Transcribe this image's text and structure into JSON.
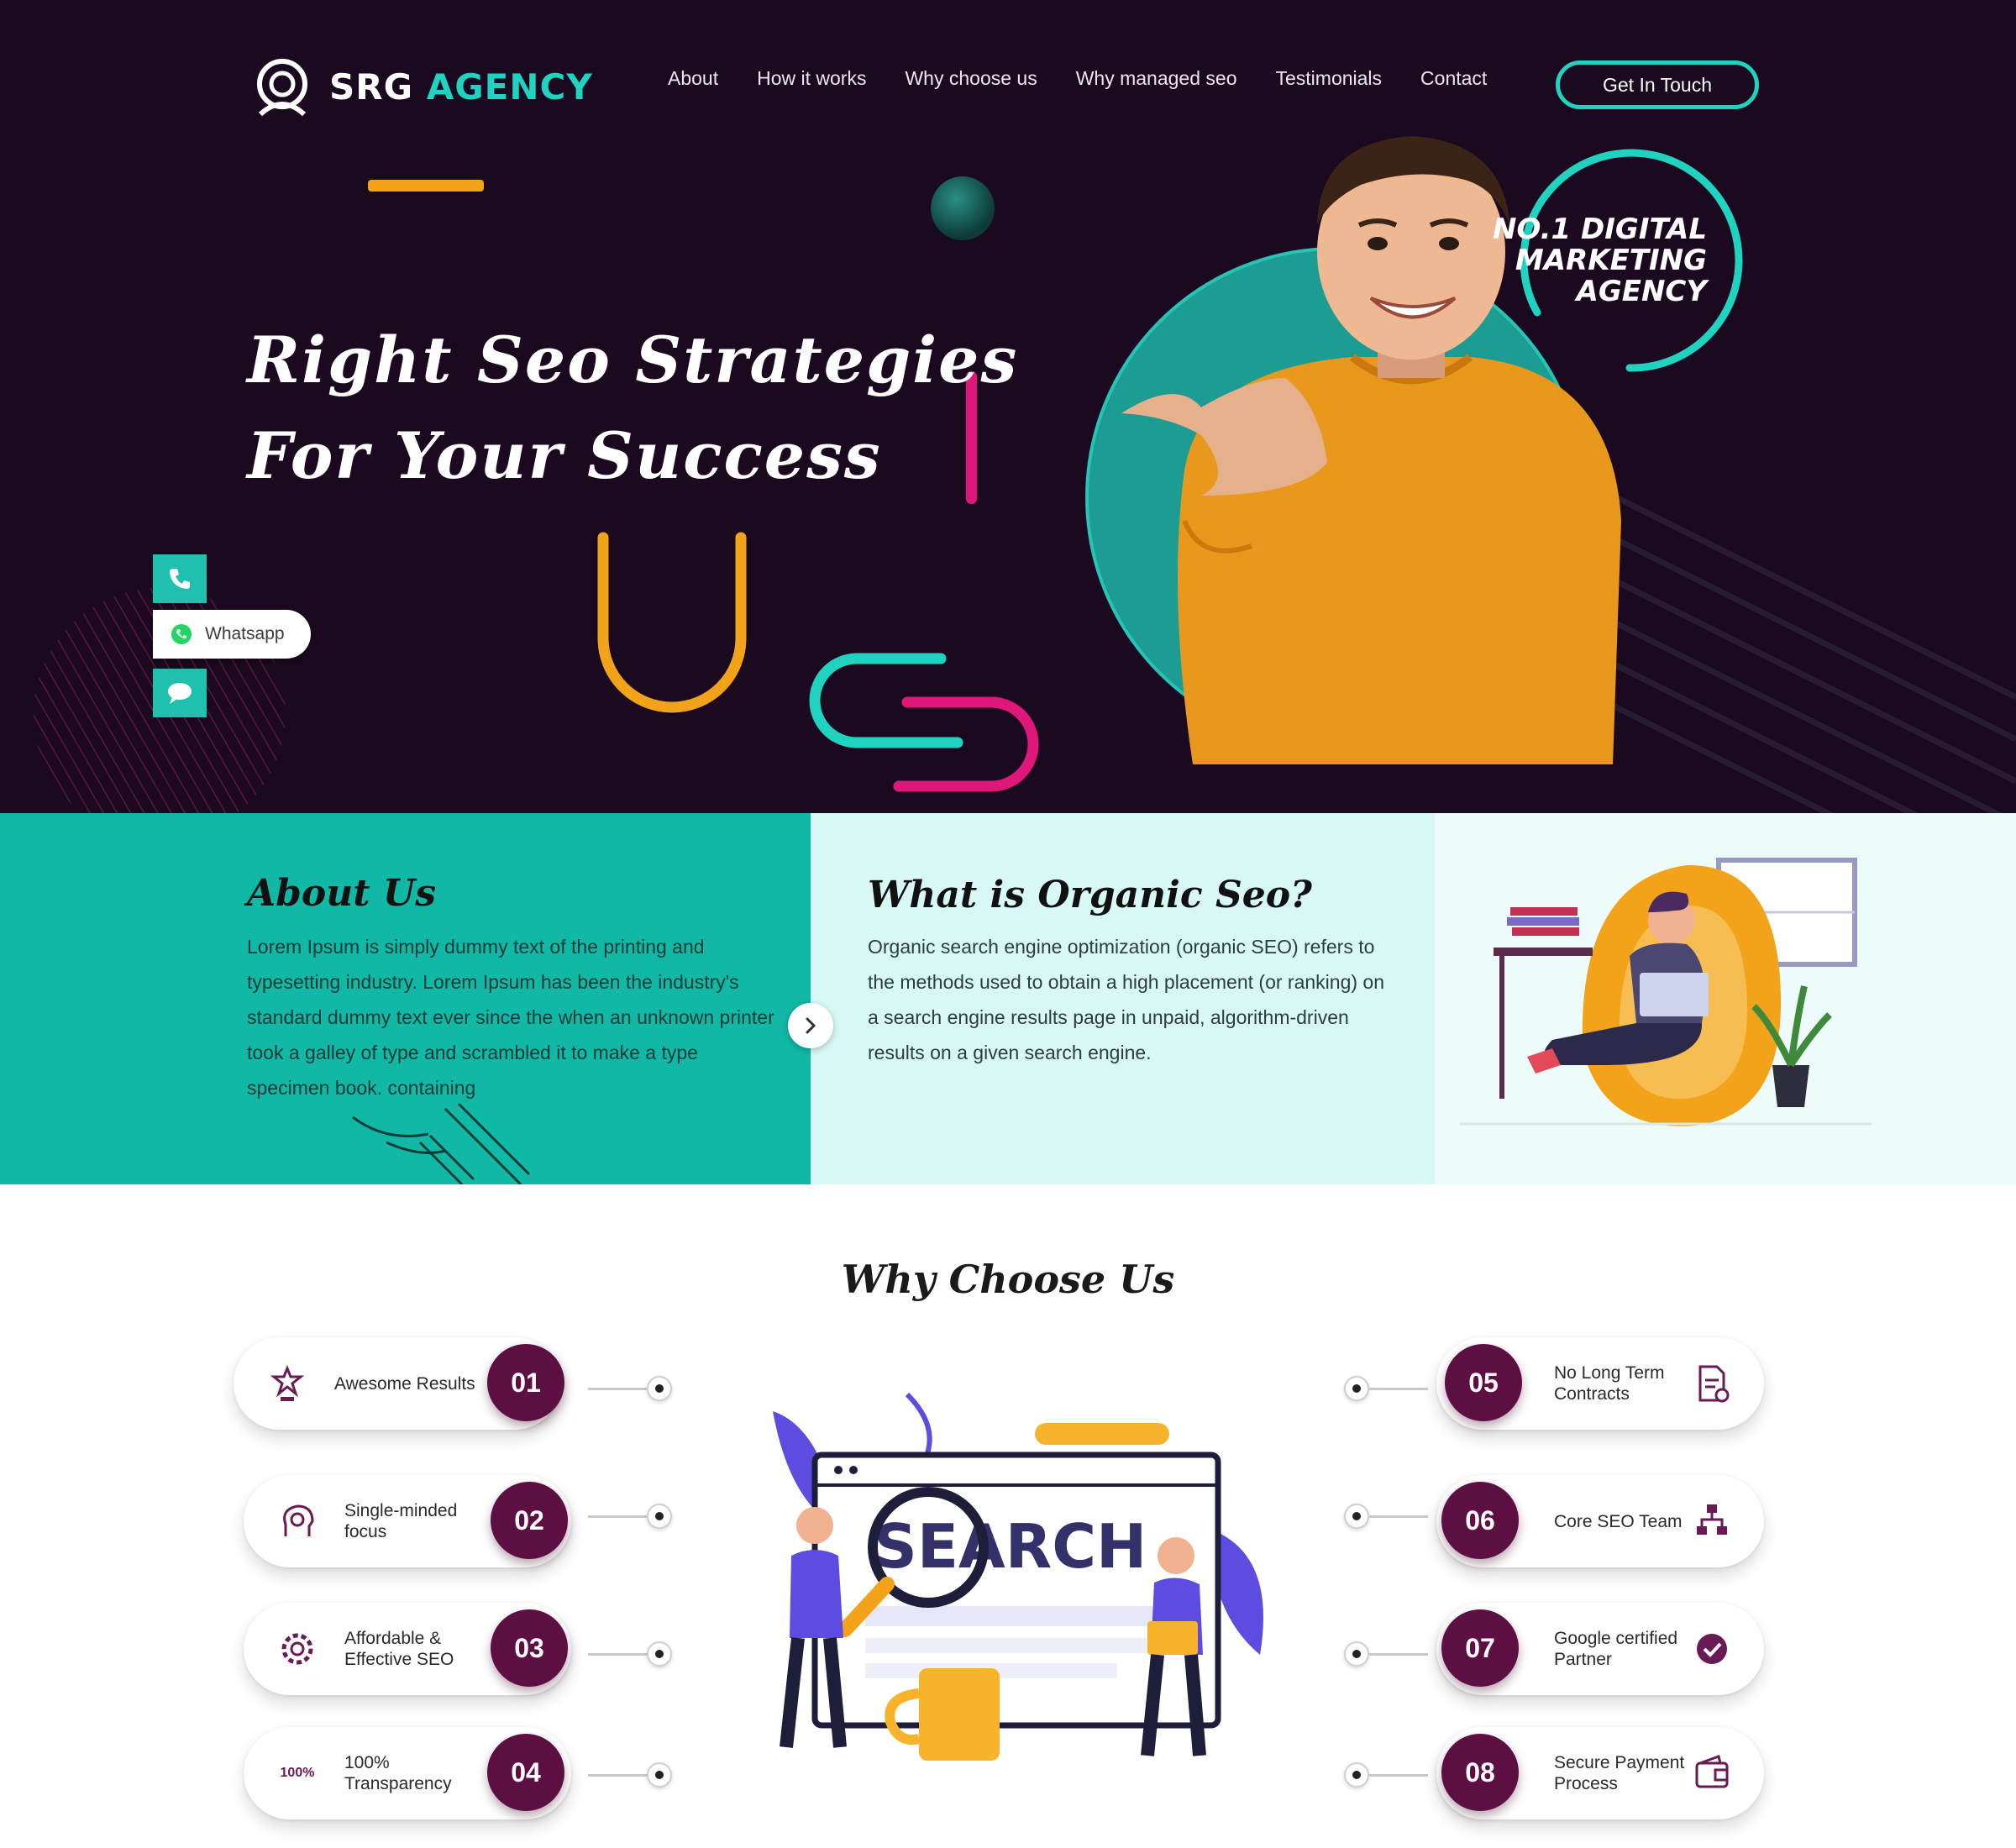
{
  "brand": {
    "name_part1": "SRG",
    "name_part2": "AGENCY"
  },
  "nav": {
    "links": [
      "About",
      "How it works",
      "Why choose us",
      "Why managed seo",
      "Testimonials",
      "Contact"
    ],
    "cta": "Get In Touch"
  },
  "hero": {
    "title_line1": "Right Seo Strategies",
    "title_line2": "For Your Success",
    "badge_line1": "NO.1 DIGITAL",
    "badge_line2": "MARKETING",
    "badge_line3": "AGENCY"
  },
  "side_buttons": {
    "whatsapp_label": "Whatsapp"
  },
  "about": {
    "title": "About Us",
    "body": "Lorem Ipsum is simply dummy text of the printing and typesetting industry. Lorem Ipsum has been the industry's standard dummy text ever since the when an unknown printer took a galley of type and scrambled it to make a type specimen book. containing"
  },
  "organic": {
    "title": "What is Organic Seo?",
    "body": "Organic search engine optimization (organic SEO) refers to the methods used to obtain a high placement (or ranking) on a search engine results page in unpaid, algorithm-driven results on a given search engine."
  },
  "why": {
    "title": "Why Choose Us",
    "search_word": "SEARCH",
    "left": [
      {
        "num": "01",
        "label": "Awesome Results",
        "icon": "trophy-icon"
      },
      {
        "num": "02",
        "label": "Single-minded focus",
        "icon": "head-target-icon"
      },
      {
        "num": "03",
        "label": "Affordable & Effective SEO",
        "icon": "gear-target-icon"
      },
      {
        "num": "04",
        "label": "100% Transparency",
        "icon": "percent-100-icon",
        "icon_text": "100%"
      }
    ],
    "right": [
      {
        "num": "05",
        "label": "No Long Term Contracts",
        "icon": "contract-icon"
      },
      {
        "num": "06",
        "label": "Core SEO Team",
        "icon": "team-hierarchy-icon"
      },
      {
        "num": "07",
        "label": "Google certified Partner",
        "icon": "certified-badge-icon"
      },
      {
        "num": "08",
        "label": "Secure Payment Process",
        "icon": "wallet-icon"
      }
    ]
  },
  "colors": {
    "hero_bg": "#1b0a1f",
    "teal": "#1fd3c0",
    "about_bg": "#12b8a6",
    "organic_bg": "#d7f8f5",
    "number_badge": "#5d0e42",
    "orange_sweater": "#e89a1c",
    "pink_accent": "#e0177a"
  }
}
